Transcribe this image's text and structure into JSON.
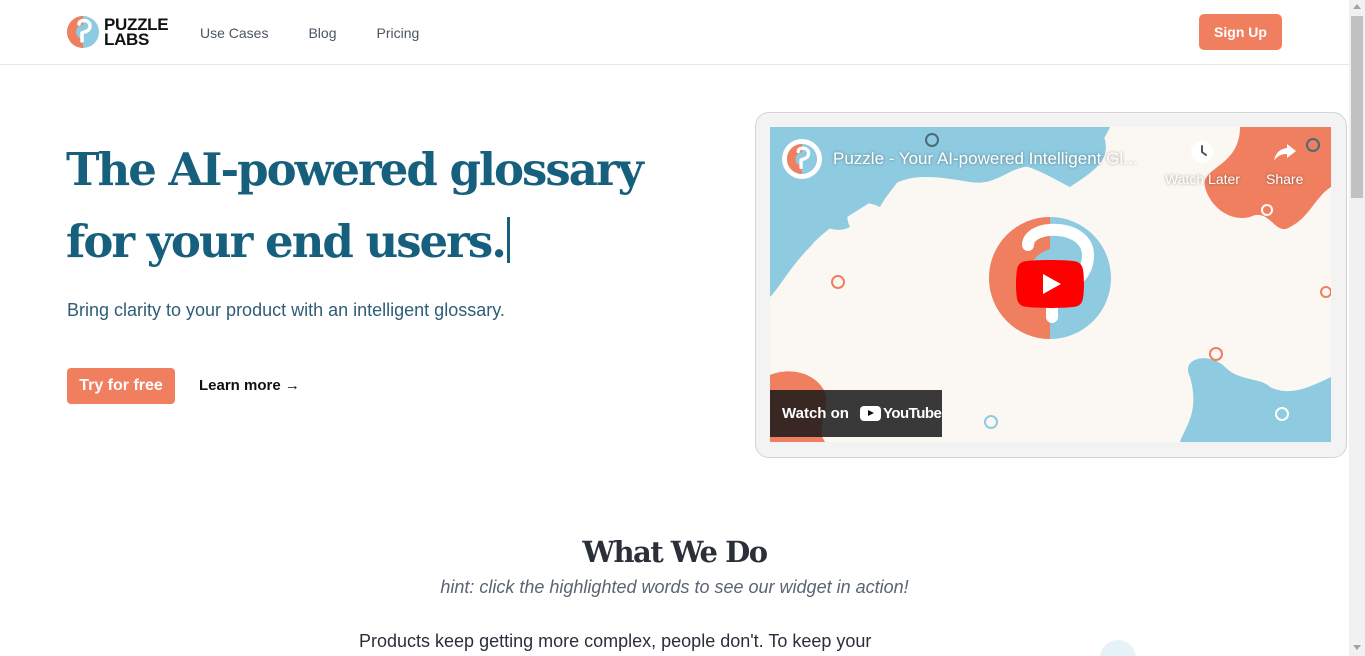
{
  "brand": {
    "name_line1": "PUZZLE",
    "name_line2": "LABS",
    "colors": {
      "primary": "#17607d",
      "accent": "#ef7f5f",
      "light_blue": "#8ecae0"
    }
  },
  "nav": {
    "items": [
      {
        "label": "Use Cases"
      },
      {
        "label": "Blog"
      },
      {
        "label": "Pricing"
      }
    ],
    "signup_label": "Sign Up"
  },
  "hero": {
    "title_line1": "The AI-powered glossary",
    "title_line2": "for your end users.",
    "subtitle": "Bring clarity to your product with an intelligent glossary.",
    "try_label": "Try for free",
    "learn_label": "Learn more →"
  },
  "video": {
    "title": "Puzzle - Your AI-powered Intelligent Gl...",
    "watch_later_label": "Watch Later",
    "share_label": "Share",
    "watch_on_label": "Watch on",
    "youtube_label": "YouTube",
    "icons": [
      "channel-avatar-icon",
      "clock-icon",
      "share-arrow-icon",
      "youtube-play-icon"
    ]
  },
  "what_we_do": {
    "title": "What We Do",
    "hint": "hint: click the highlighted words to see our widget in action!",
    "body_start": "Products keep getting more complex, people don't. To keep your"
  }
}
